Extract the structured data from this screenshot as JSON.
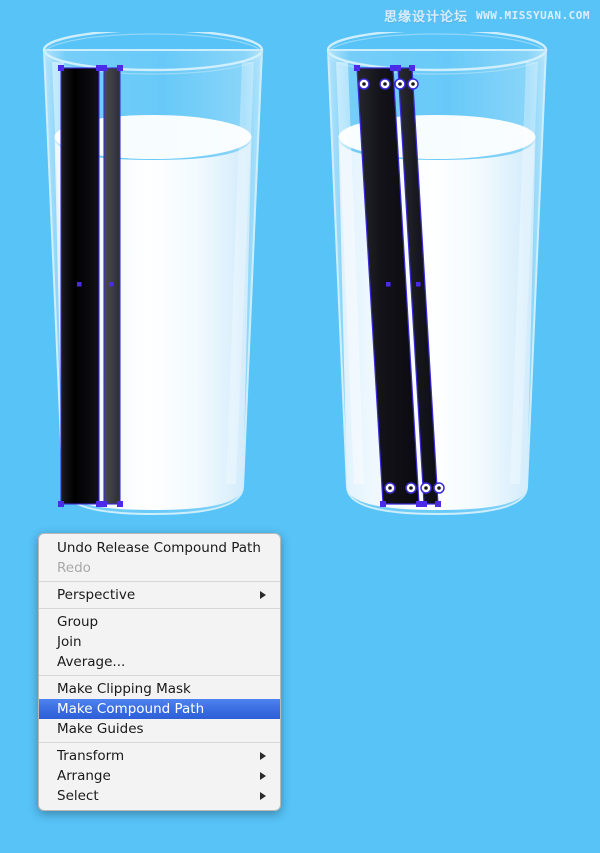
{
  "background": {
    "color": "#57c3f7"
  },
  "watermark": {
    "chinese": "思缘设计论坛",
    "url": "WWW.MISSYUAN.COM"
  },
  "artboard": {
    "title": "Adobe Illustrator artwork: two milk glasses with selected straw paths",
    "glasses": [
      {
        "name": "glass-left",
        "state": "straws-straight-vertical",
        "straws": [
          {
            "name": "straw-wide-black",
            "fill": "#000000",
            "selected": true,
            "anchor_style": "square"
          },
          {
            "name": "straw-narrow-gray",
            "fill": "#3f3f44",
            "selected": true,
            "anchor_style": "square"
          }
        ],
        "milk_color": "#ffffff",
        "glass_tint": "#bfe6fb"
      },
      {
        "name": "glass-right",
        "state": "straws-tilted-compound-path",
        "straws": [
          {
            "name": "straw-wide-black",
            "fill": "#1b1b22",
            "selected": true,
            "anchor_style": "circle"
          },
          {
            "name": "straw-narrow-black",
            "fill": "#1b1b22",
            "selected": true,
            "anchor_style": "circle"
          }
        ],
        "milk_color": "#ffffff",
        "glass_tint": "#bfe6fb"
      }
    ],
    "selection_color": "#3a2bd8",
    "anchor_point_color": "#4b2ae8"
  },
  "context_menu": {
    "highlight_color": "#3a6ee2",
    "background_color": "#f3f3f3",
    "groups": [
      {
        "items": [
          {
            "label": "Undo Release Compound Path",
            "disabled": false,
            "submenu": false,
            "highlighted": false
          },
          {
            "label": "Redo",
            "disabled": true,
            "submenu": false,
            "highlighted": false
          }
        ]
      },
      {
        "items": [
          {
            "label": "Perspective",
            "disabled": false,
            "submenu": true,
            "highlighted": false
          }
        ]
      },
      {
        "items": [
          {
            "label": "Group",
            "disabled": false,
            "submenu": false,
            "highlighted": false
          },
          {
            "label": "Join",
            "disabled": false,
            "submenu": false,
            "highlighted": false
          },
          {
            "label": "Average...",
            "disabled": false,
            "submenu": false,
            "highlighted": false
          }
        ]
      },
      {
        "items": [
          {
            "label": "Make Clipping Mask",
            "disabled": false,
            "submenu": false,
            "highlighted": false
          },
          {
            "label": "Make Compound Path",
            "disabled": false,
            "submenu": false,
            "highlighted": true
          },
          {
            "label": "Make Guides",
            "disabled": false,
            "submenu": false,
            "highlighted": false
          }
        ]
      },
      {
        "items": [
          {
            "label": "Transform",
            "disabled": false,
            "submenu": true,
            "highlighted": false
          },
          {
            "label": "Arrange",
            "disabled": false,
            "submenu": true,
            "highlighted": false
          },
          {
            "label": "Select",
            "disabled": false,
            "submenu": true,
            "highlighted": false
          }
        ]
      }
    ]
  }
}
